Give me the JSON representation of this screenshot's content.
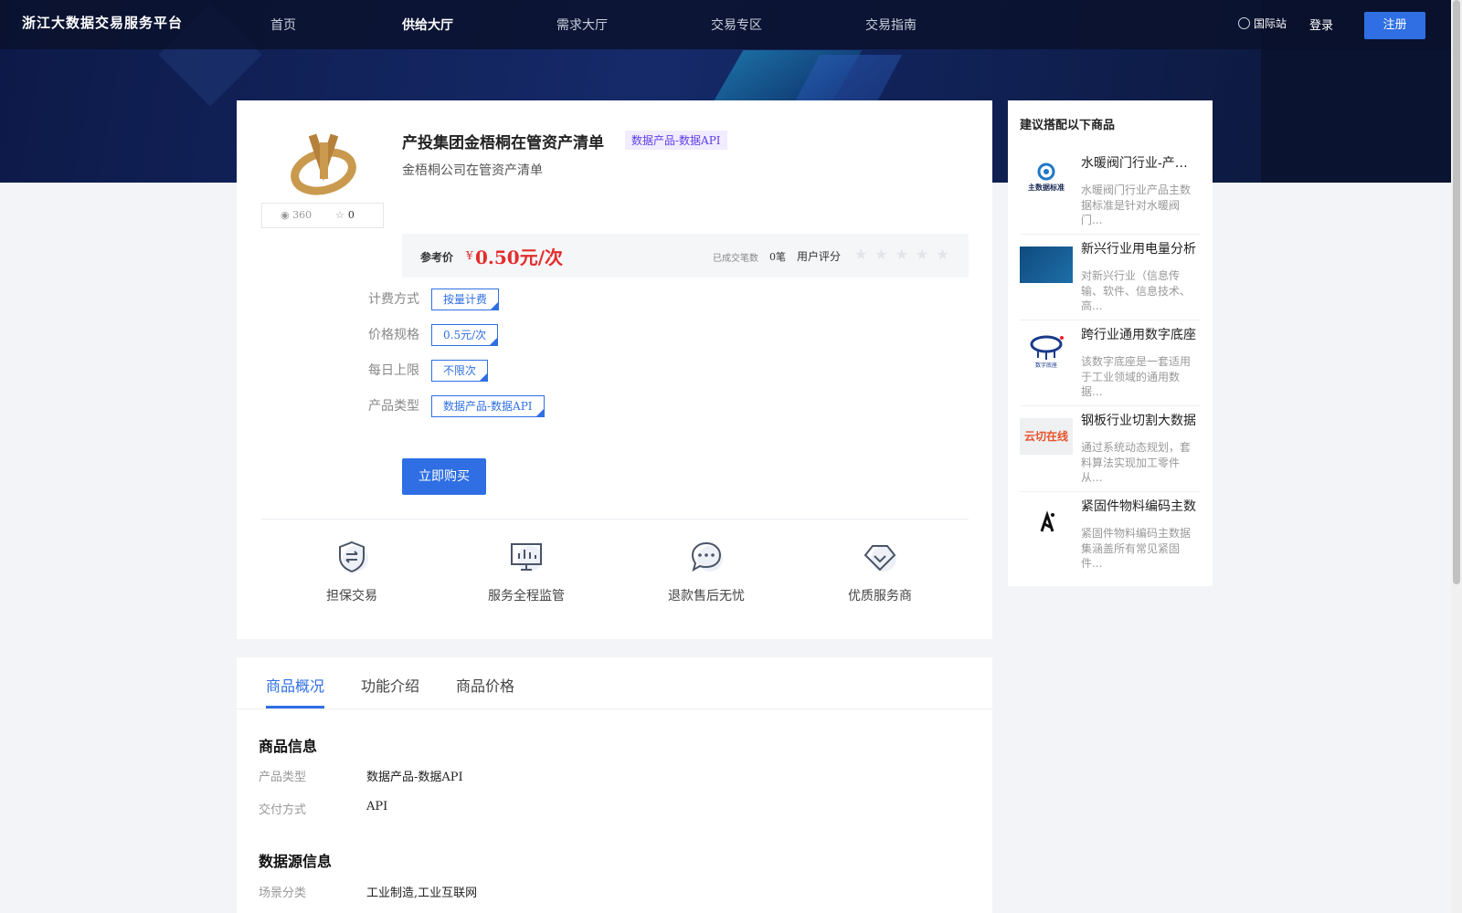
{
  "nav": {
    "brand": "浙江大数据交易服务平台",
    "items": [
      "首页",
      "供给大厅",
      "需求大厅",
      "交易专区",
      "交易指南"
    ],
    "intl": "国际站",
    "login": "登录",
    "register": "注册"
  },
  "product": {
    "title": "产投集团金梧桐在管资产清单",
    "tag": "数据产品-数据API",
    "subtitle": "金梧桐公司在管资产清单",
    "views": "360",
    "stars_count": "0",
    "price_label": "参考价",
    "price_currency": "¥",
    "price": "0.50元/次",
    "deals_label": "已成交笔数",
    "deals": "0笔",
    "rating_label": "用户评分",
    "rating": 0,
    "specs": [
      {
        "label": "计费方式",
        "value": "按量计费"
      },
      {
        "label": "价格规格",
        "value": "0.5元/次"
      },
      {
        "label": "每日上限",
        "value": "不限次"
      },
      {
        "label": "产品类型",
        "value": "数据产品-数据API"
      }
    ],
    "buy_button": "立即购买"
  },
  "features": [
    "担保交易",
    "服务全程监管",
    "退款售后无忧",
    "优质服务商"
  ],
  "sidebar": {
    "title": "建议搭配以下商品",
    "items": [
      {
        "name": "水暖阀门行业-产品主数据标准",
        "desc": "水暖阀门行业产品主数据标准是针对水暖阀门...",
        "thumb_text": "主数据标准"
      },
      {
        "name": "新兴行业用电量分析",
        "desc": "对新兴行业（信息传输、软件、信息技术、高...",
        "thumb_text": ""
      },
      {
        "name": "跨行业通用数字底座",
        "desc": "该数字底座是一套适用于工业领域的通用数据...",
        "thumb_text": "数字底座"
      },
      {
        "name": "钢板行业切割大数据",
        "desc": "通过系统动态规划，套料算法实现加工零件从...",
        "thumb_text": "云切在线"
      },
      {
        "name": "紧固件物料编码主数",
        "desc": "紧固件物料编码主数据集涵盖所有常见紧固件...",
        "thumb_text": ""
      }
    ]
  },
  "tabs": [
    "商品概况",
    "功能介绍",
    "商品价格"
  ],
  "details": {
    "section1_title": "商品信息",
    "product_type_label": "产品类型",
    "product_type": "数据产品-数据API",
    "delivery_label": "交付方式",
    "delivery": "API",
    "section2_title": "数据源信息",
    "scene_label": "场景分类",
    "scene": "工业制造,工业互联网"
  },
  "colors": {
    "accent": "#2f6fe3",
    "price": "#e32d2d",
    "tag_bg": "#f2ecff",
    "tag_text": "#5b3ee8"
  }
}
